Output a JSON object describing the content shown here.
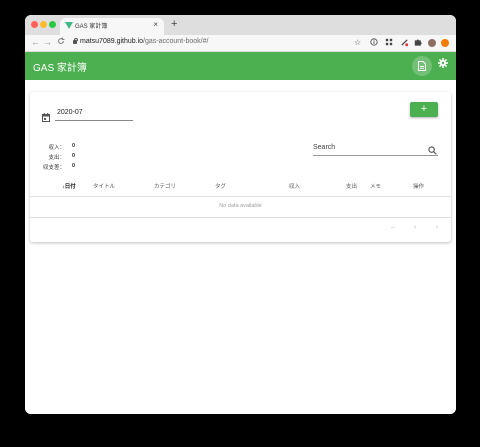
{
  "browser": {
    "tab_title": "GAS 家計簿",
    "tab_close": "×",
    "new_tab": "+",
    "back": "←",
    "forward": "→",
    "reload": "C",
    "url_host": "matsu7089.github.io",
    "url_path": "/gas-account-book/#/",
    "star": "☆",
    "window_dots": {
      "close": "#ff5f57",
      "minimize": "#febc2e",
      "maximize": "#28c840"
    }
  },
  "app": {
    "title": "GAS 家計簿",
    "accent": "#4caf50"
  },
  "filters": {
    "month": "2020-07",
    "add_label": "+"
  },
  "summary": [
    {
      "label": "収入：",
      "value": "0"
    },
    {
      "label": "支出：",
      "value": "0"
    },
    {
      "label": "収支差：",
      "value": "0"
    }
  ],
  "search": {
    "placeholder": "Search"
  },
  "table": {
    "headers": [
      "日付",
      "タイトル",
      "カテゴリ",
      "タグ",
      "収入",
      "支出",
      "メモ",
      "操作"
    ],
    "sort_arrow": "↓",
    "empty_text": "No data available"
  },
  "pagination": {
    "range": "–",
    "prev": "‹",
    "next": "›"
  }
}
